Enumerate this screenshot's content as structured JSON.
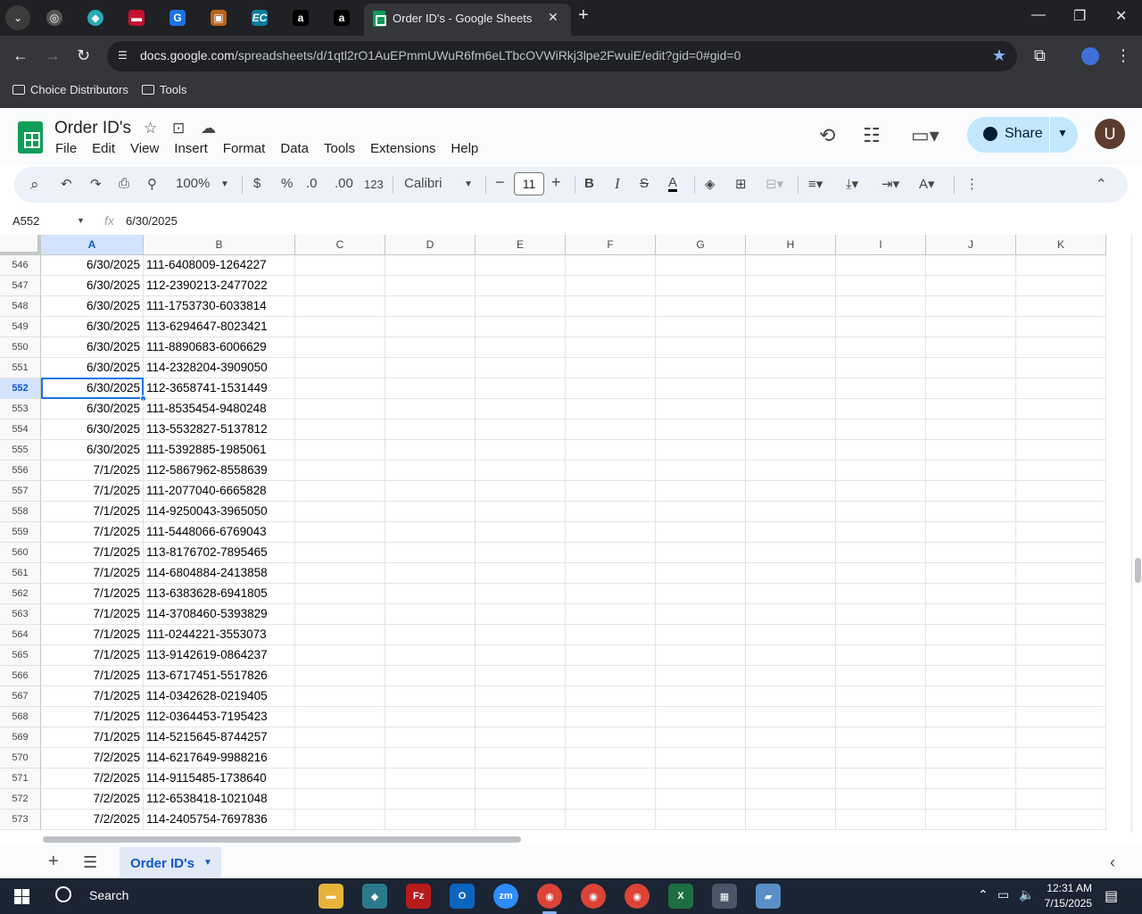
{
  "browser": {
    "active_tab_title": "Order ID's - Google Sheets",
    "url_domain": "docs.google.com",
    "url_path": "/spreadsheets/d/1qtl2rO1AuEPmmUWuR6fm6eLTbcOVWiRkj3lpe2FwuiE/edit?gid=0#gid=0",
    "bookmarks": [
      "Choice Distributors",
      "Tools"
    ]
  },
  "doc": {
    "title": "Order ID's",
    "menus": [
      "File",
      "Edit",
      "View",
      "Insert",
      "Format",
      "Data",
      "Tools",
      "Extensions",
      "Help"
    ],
    "share_label": "Share",
    "avatar_letter": "U"
  },
  "toolbar": {
    "zoom": "100%",
    "currency": "$",
    "percent": "%",
    "decimal_decrease": ".0",
    "decimal_increase": ".00",
    "number_format": "123",
    "font": "Calibri",
    "font_size": "11",
    "bold": "B",
    "italic": "I"
  },
  "formula_bar": {
    "name_box": "A552",
    "value": "6/30/2025"
  },
  "grid": {
    "columns": [
      "A",
      "B",
      "C",
      "D",
      "E",
      "F",
      "G",
      "H",
      "I",
      "J",
      "K"
    ],
    "selected_column": "A",
    "selected_row": "552",
    "rows": [
      {
        "num": "546",
        "a": "6/30/2025",
        "b": "111-6408009-1264227"
      },
      {
        "num": "547",
        "a": "6/30/2025",
        "b": "112-2390213-2477022"
      },
      {
        "num": "548",
        "a": "6/30/2025",
        "b": "111-1753730-6033814"
      },
      {
        "num": "549",
        "a": "6/30/2025",
        "b": "113-6294647-8023421"
      },
      {
        "num": "550",
        "a": "6/30/2025",
        "b": "111-8890683-6006629"
      },
      {
        "num": "551",
        "a": "6/30/2025",
        "b": "114-2328204-3909050"
      },
      {
        "num": "552",
        "a": "6/30/2025",
        "b": "112-3658741-1531449"
      },
      {
        "num": "553",
        "a": "6/30/2025",
        "b": "111-8535454-9480248"
      },
      {
        "num": "554",
        "a": "6/30/2025",
        "b": "113-5532827-5137812"
      },
      {
        "num": "555",
        "a": "6/30/2025",
        "b": "111-5392885-1985061"
      },
      {
        "num": "556",
        "a": "7/1/2025",
        "b": "112-5867962-8558639"
      },
      {
        "num": "557",
        "a": "7/1/2025",
        "b": "111-2077040-6665828"
      },
      {
        "num": "558",
        "a": "7/1/2025",
        "b": "114-9250043-3965050"
      },
      {
        "num": "559",
        "a": "7/1/2025",
        "b": "111-5448066-6769043"
      },
      {
        "num": "560",
        "a": "7/1/2025",
        "b": "113-8176702-7895465"
      },
      {
        "num": "561",
        "a": "7/1/2025",
        "b": "114-6804884-2413858"
      },
      {
        "num": "562",
        "a": "7/1/2025",
        "b": "113-6383628-6941805"
      },
      {
        "num": "563",
        "a": "7/1/2025",
        "b": "114-3708460-5393829"
      },
      {
        "num": "564",
        "a": "7/1/2025",
        "b": "111-0244221-3553073"
      },
      {
        "num": "565",
        "a": "7/1/2025",
        "b": "113-9142619-0864237"
      },
      {
        "num": "566",
        "a": "7/1/2025",
        "b": "113-6717451-5517826"
      },
      {
        "num": "567",
        "a": "7/1/2025",
        "b": "114-0342628-0219405"
      },
      {
        "num": "568",
        "a": "7/1/2025",
        "b": "112-0364453-7195423"
      },
      {
        "num": "569",
        "a": "7/1/2025",
        "b": "114-5215645-8744257"
      },
      {
        "num": "570",
        "a": "7/2/2025",
        "b": "114-6217649-9988216"
      },
      {
        "num": "571",
        "a": "7/2/2025",
        "b": "114-9115485-1738640"
      },
      {
        "num": "572",
        "a": "7/2/2025",
        "b": "112-6538418-1021048"
      },
      {
        "num": "573",
        "a": "7/2/2025",
        "b": "114-2405754-7697836"
      }
    ]
  },
  "sheet_tabs": {
    "active": "Order ID's"
  },
  "taskbar": {
    "search_label": "Search",
    "time": "12:31 AM",
    "date": "7/15/2025"
  },
  "colors": {
    "accent": "#1a73e8",
    "sheets_green": "#0f9d58",
    "share_bg": "#c2e7ff",
    "selected_header": "#d3e3fd"
  }
}
